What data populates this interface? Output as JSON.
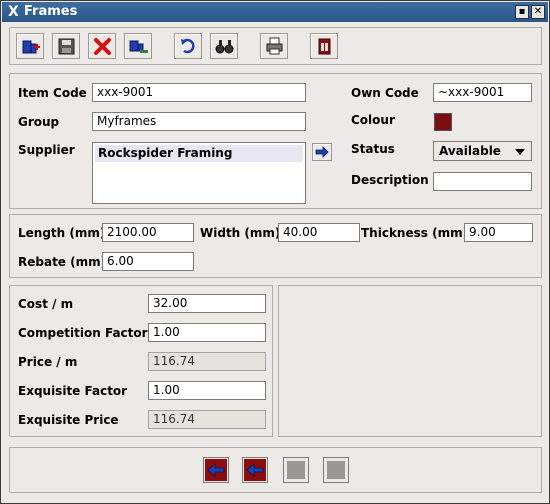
{
  "window": {
    "title": "Frames",
    "app_icon": "X",
    "minimize_glyph": "▪",
    "close_glyph": "✕"
  },
  "toolbar": {
    "buttons": [
      {
        "name": "new-record-icon"
      },
      {
        "name": "save-icon"
      },
      {
        "name": "delete-icon"
      },
      {
        "name": "copy-record-icon"
      },
      {
        "name": "undo-icon"
      },
      {
        "name": "find-icon"
      },
      {
        "name": "print-icon"
      },
      {
        "name": "exit-icon"
      }
    ]
  },
  "details": {
    "item_code_label": "Item Code",
    "item_code_value": "xxx-9001",
    "group_label": "Group",
    "group_value": "Myframes",
    "supplier_label": "Supplier",
    "supplier_items": [
      "Rockspider Framing"
    ],
    "own_code_label": "Own Code",
    "own_code_value": "~xxx-9001",
    "colour_label": "Colour",
    "colour_value": "#7a0e10",
    "status_label": "Status",
    "status_value": "Available",
    "description_label": "Description",
    "description_value": ""
  },
  "dimensions": {
    "length_label": "Length (mm)",
    "length_value": "2100.00",
    "width_label": "Width (mm)",
    "width_value": "40.00",
    "thickness_label": "Thickness (mm)",
    "thickness_value": "9.00",
    "rebate_label": "Rebate (mm)",
    "rebate_value": "6.00"
  },
  "pricing": {
    "cost_label": "Cost / m",
    "cost_value": "32.00",
    "competition_label": "Competition Factor",
    "competition_value": "1.00",
    "price_label": "Price / m",
    "price_value": "116.74",
    "exquisite_factor_label": "Exquisite Factor",
    "exquisite_factor_value": "1.00",
    "exquisite_price_label": "Exquisite Price",
    "exquisite_price_value": "116.74"
  },
  "nav": {
    "buttons": [
      {
        "name": "first-record-icon",
        "enabled": true
      },
      {
        "name": "previous-record-icon",
        "enabled": true
      },
      {
        "name": "next-record-icon",
        "enabled": false
      },
      {
        "name": "last-record-icon",
        "enabled": false
      }
    ]
  }
}
